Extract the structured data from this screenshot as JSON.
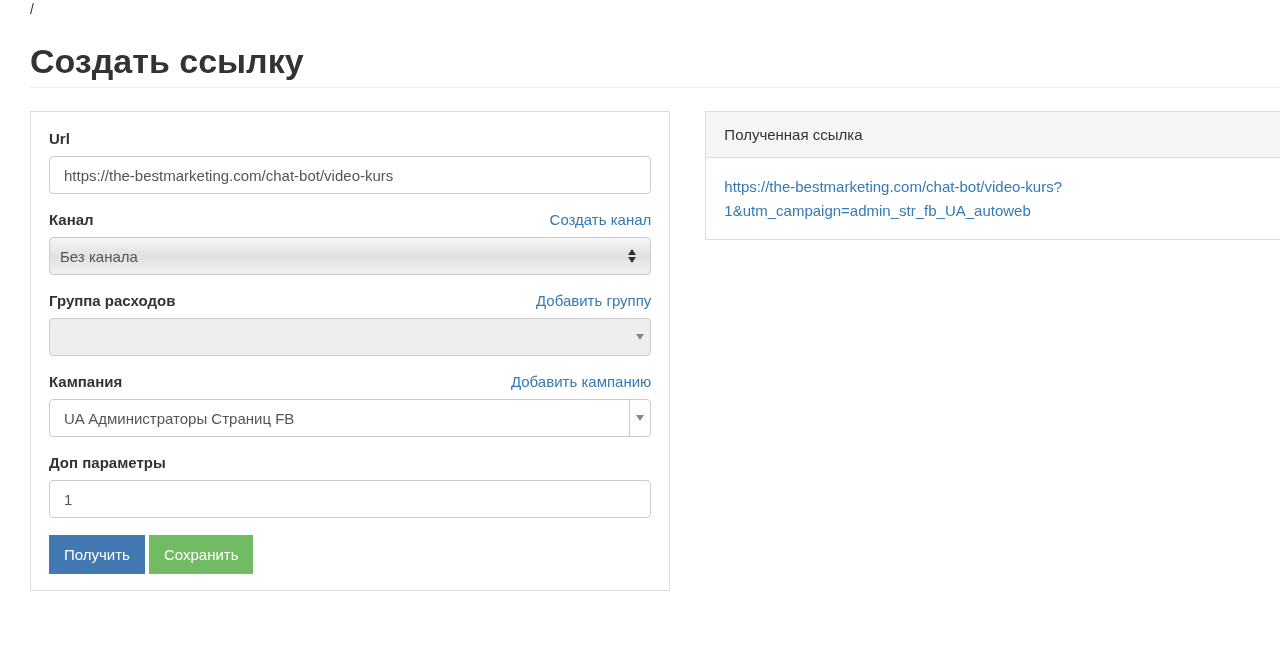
{
  "breadcrumb": "/",
  "title": "Создать ссылку",
  "form": {
    "fields": [
      {
        "label": "Url",
        "kind": "text",
        "value": "https://the-bestmarketing.com/chat-bot/video-kurs",
        "disabled": false
      },
      {
        "label": "Канал",
        "action": "Создать канал",
        "kind": "native-select",
        "value": "Без канала",
        "disabled": false
      },
      {
        "label": "Группа расходов",
        "action": "Добавить группу",
        "kind": "combo",
        "disabled": true
      },
      {
        "label": "Кампания",
        "action": "Добавить кампанию",
        "kind": "combo",
        "value": "UA Администраторы Страниц FB",
        "disabled": false
      },
      {
        "label": "Доп параметры",
        "kind": "text",
        "value": "1",
        "disabled": false
      }
    ],
    "buttons": [
      {
        "label": "Получить",
        "kind": "primary"
      },
      {
        "label": "Сохранить",
        "kind": "success"
      }
    ]
  },
  "result": {
    "heading": "Полученная ссылка",
    "link_lines": [
      "https://the-bestmarketing.com/chat-bot/video-kurs?",
      "1&utm_campaign=admin_str_fb_UA_autoweb"
    ]
  }
}
